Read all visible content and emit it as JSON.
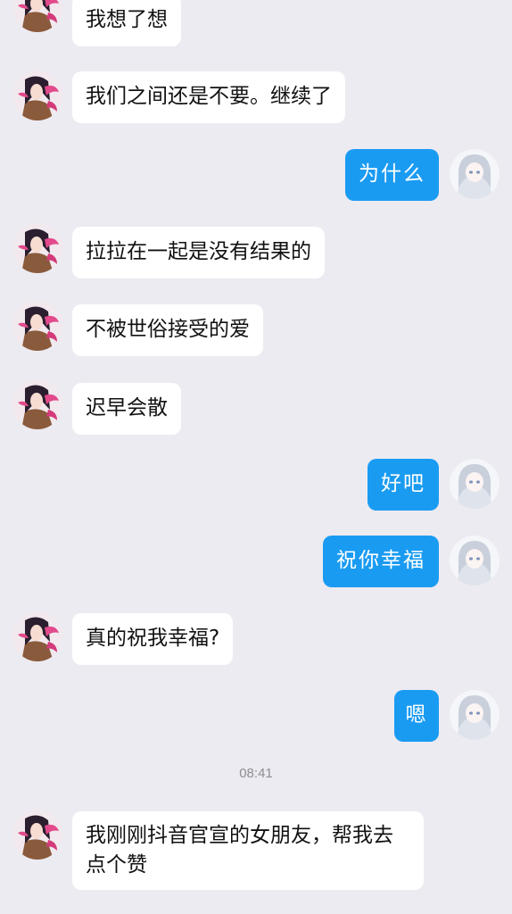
{
  "chat": {
    "messages": [
      {
        "side": "left",
        "text": "我想了想"
      },
      {
        "side": "left",
        "text": "我们之间还是不要。继续了"
      },
      {
        "side": "right",
        "text": "为什么"
      },
      {
        "side": "left",
        "text": "拉拉在一起是没有结果的"
      },
      {
        "side": "left",
        "text": "不被世俗接受的爱"
      },
      {
        "side": "left",
        "text": "迟早会散"
      },
      {
        "side": "right",
        "text": "好吧"
      },
      {
        "side": "right",
        "text": "祝你幸福"
      },
      {
        "side": "left",
        "text": "真的祝我幸福?"
      },
      {
        "side": "right",
        "text": "嗯"
      },
      {
        "side": "left",
        "text": "我刚刚抖音官宣的女朋友，帮我去点个赞"
      }
    ],
    "timestamp": "08:41"
  },
  "colors": {
    "background": "#ecebf1",
    "incoming_bubble": "#ffffff",
    "outgoing_bubble": "#1a9bf2"
  },
  "icons": {
    "incoming_avatar": "anime-girl-dark-hair-avatar",
    "outgoing_avatar": "anime-girl-white-hair-avatar"
  }
}
